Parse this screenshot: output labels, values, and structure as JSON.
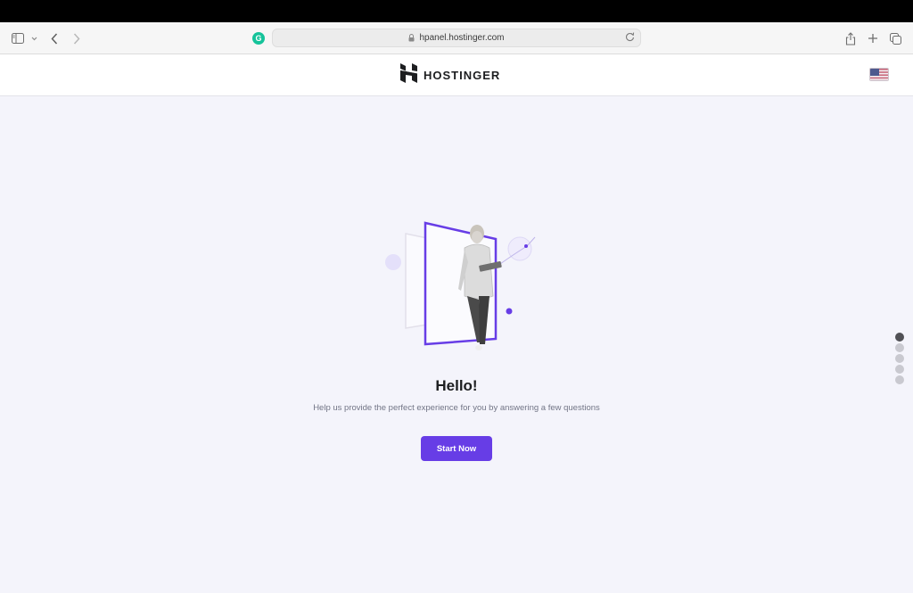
{
  "browser": {
    "url": "hpanel.hostinger.com",
    "grammarly_letter": "G",
    "icons": [
      "sidebar-icon",
      "chevron-down-icon",
      "back-icon",
      "forward-icon",
      "grammarly-icon",
      "lock-icon",
      "reload-icon",
      "share-icon",
      "new-tab-icon",
      "tabs-overview-icon"
    ]
  },
  "header": {
    "brand": "HOSTINGER",
    "language_flag": "us-flag"
  },
  "main": {
    "title": "Hello!",
    "subtitle": "Help us provide the perfect experience for you by answering a few questions",
    "start_button": "Start Now",
    "progress": {
      "total_steps": 5,
      "current_step": 1
    }
  },
  "colors": {
    "accent": "#673de6",
    "page_background": "#f4f4fb",
    "text_dark": "#1d1e20",
    "text_muted": "#727586"
  }
}
